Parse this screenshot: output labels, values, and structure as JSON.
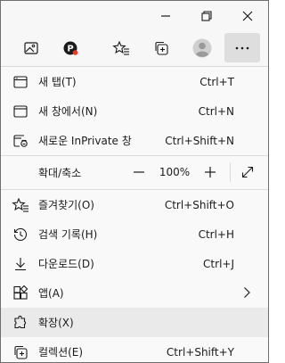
{
  "window_controls": {
    "minimize_icon": "minimize-icon",
    "restore_icon": "restore-icon",
    "close_icon": "close-icon"
  },
  "toolbar": {
    "icons": [
      "image-icon",
      "extension-p-icon",
      "favorites-star-icon",
      "collections-icon",
      "profile-avatar-icon",
      "more-dots-icon"
    ]
  },
  "menu": {
    "new_tab": {
      "label": "새 탭(T)",
      "shortcut": "Ctrl+T"
    },
    "new_window": {
      "label": "새 창에서(N)",
      "shortcut": "Ctrl+N"
    },
    "new_inprivate": {
      "label": "새로운 InPrivate 창",
      "shortcut": "Ctrl+Shift+N"
    },
    "zoom": {
      "label": "확대/축소",
      "value": "100%",
      "minus": "—",
      "plus": "+"
    },
    "favorites": {
      "label": "즐겨찾기(O)",
      "shortcut": "Ctrl+Shift+O"
    },
    "history": {
      "label": "검색 기록(H)",
      "shortcut": "Ctrl+H"
    },
    "downloads": {
      "label": "다운로드(D)",
      "shortcut": "Ctrl+J"
    },
    "apps": {
      "label": "앱(A)"
    },
    "extensions": {
      "label": "확장(X)"
    },
    "collections": {
      "label": "컬렉션(E)",
      "shortcut": "Ctrl+Shift+Y"
    }
  },
  "colors": {
    "accent_avatar": "#b0b0b0",
    "hover_bg": "#eaeaea",
    "text": "#1b1b1b"
  }
}
